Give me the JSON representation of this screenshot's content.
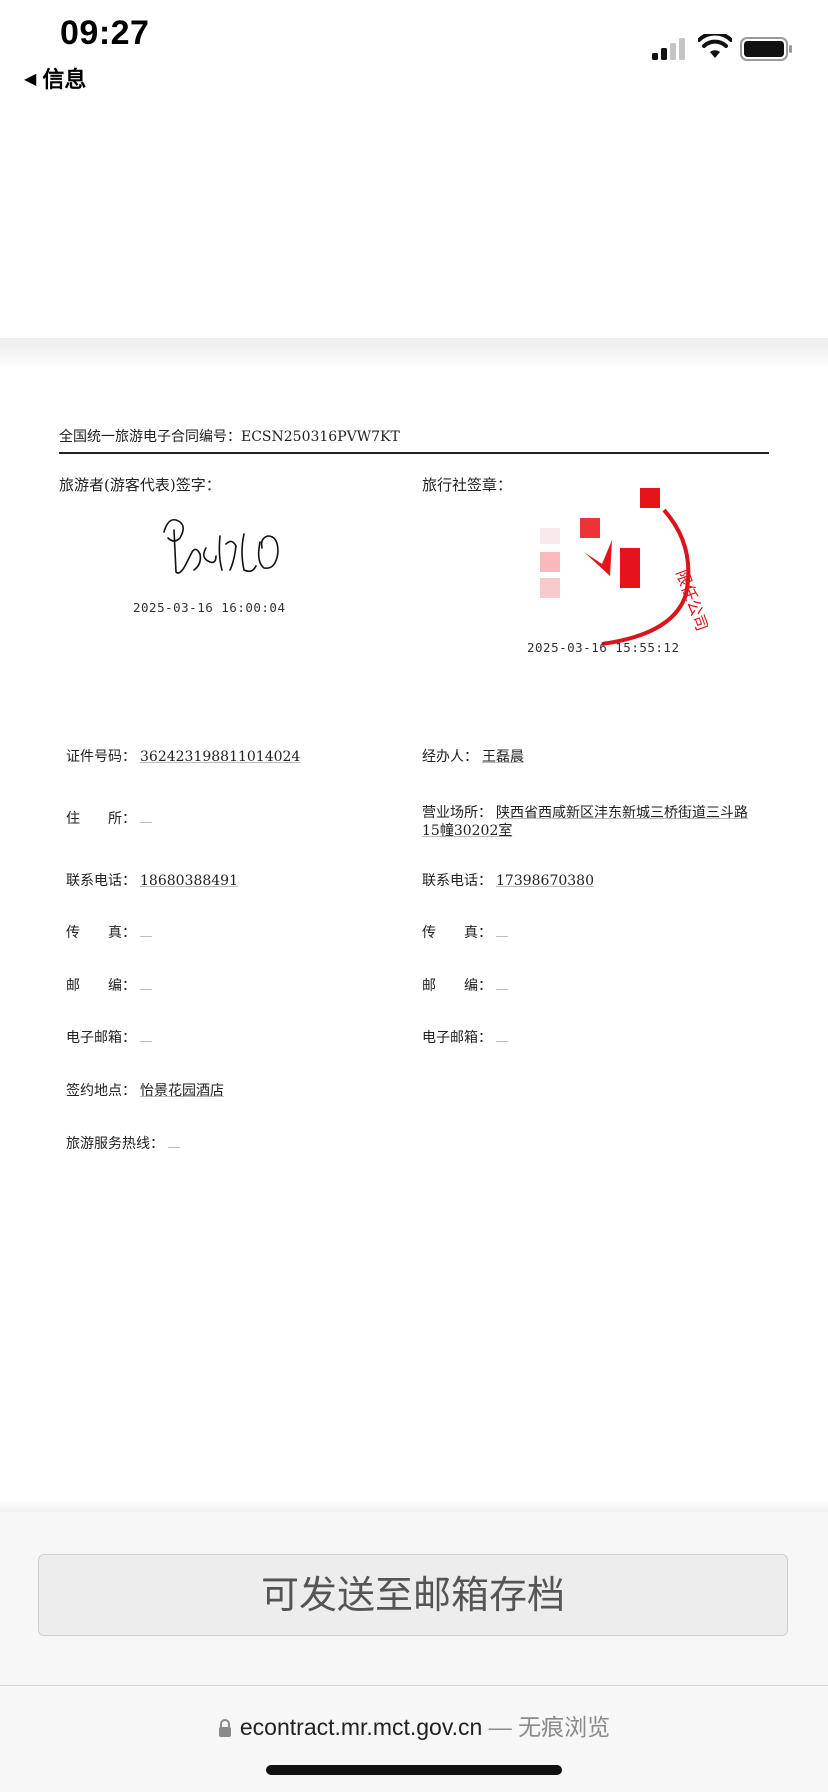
{
  "status_bar": {
    "time": "09:27",
    "back_label": "信息",
    "icons": [
      "signal-icon",
      "wifi-icon",
      "battery-icon"
    ]
  },
  "contract": {
    "header": "全国统一旅游电子合同编号：ECSN250316PVW7KT",
    "tourist_sign_label": "旅游者(游客代表)签字：",
    "tourist_sign_time": "2025-03-16 16:00:04",
    "agency_sign_label": "旅行社签章：",
    "agency_sign_time": "2025-03-16 15:55:12",
    "seal_text": "限任公司",
    "left_fields": [
      {
        "label": "证件号码：",
        "value": "362423198811014024"
      },
      {
        "label": "住　　所：",
        "value": ""
      },
      {
        "label": "联系电话：",
        "value": "18680388491"
      },
      {
        "label": "传　　真：",
        "value": ""
      },
      {
        "label": "邮　　编：",
        "value": ""
      },
      {
        "label": "电子邮箱：",
        "value": ""
      },
      {
        "label": "签约地点：",
        "value": "怡景花园酒店"
      },
      {
        "label": "旅游服务热线：",
        "value": ""
      }
    ],
    "right_fields": [
      {
        "label": "经办人：",
        "value": "王磊晨"
      },
      {
        "label": "营业场所：",
        "value": "陕西省西咸新区沣东新城三桥街道三斗路15幢30202室"
      },
      {
        "label": "联系电话：",
        "value": "17398670380"
      },
      {
        "label": "传　　真：",
        "value": ""
      },
      {
        "label": "邮　　编：",
        "value": ""
      },
      {
        "label": "电子邮箱：",
        "value": ""
      }
    ]
  },
  "footer": {
    "email_button": "可发送至邮箱存档",
    "url": "econtract.mr.mct.gov.cn",
    "browse_mode": " — 无痕浏览"
  },
  "colors": {
    "seal_red": "#d9151b",
    "button_bg": "#ededed",
    "button_text": "#555555"
  }
}
